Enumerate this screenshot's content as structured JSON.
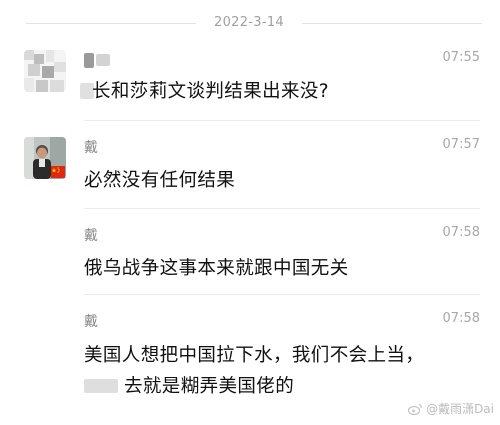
{
  "date_divider": "2022-3-14",
  "messages": [
    {
      "sender": "",
      "time": "07:55",
      "text": "长和莎莉文谈判结果出来没?"
    },
    {
      "sender": "戴",
      "time": "07:57",
      "text": "必然没有任何结果"
    },
    {
      "sender": "戴",
      "time": "07:58",
      "text": "俄乌战争这事本来就跟中国无关"
    },
    {
      "sender": "戴",
      "time": "07:58",
      "text_line1": "美国人想把中国拉下水，我们不会上当，",
      "text_line2": "去就是糊弄美国佬的"
    }
  ],
  "watermark": "@戴雨潇Dai",
  "colors": {
    "background": "#ffffff",
    "text": "#111111",
    "meta": "#a8a8a8",
    "flag_red": "#de2910",
    "flag_yellow": "#ffde00"
  },
  "icons": [
    "pixelated-avatar-icon",
    "user-avatar-photo",
    "china-flag-icon",
    "weibo-logo-icon"
  ]
}
